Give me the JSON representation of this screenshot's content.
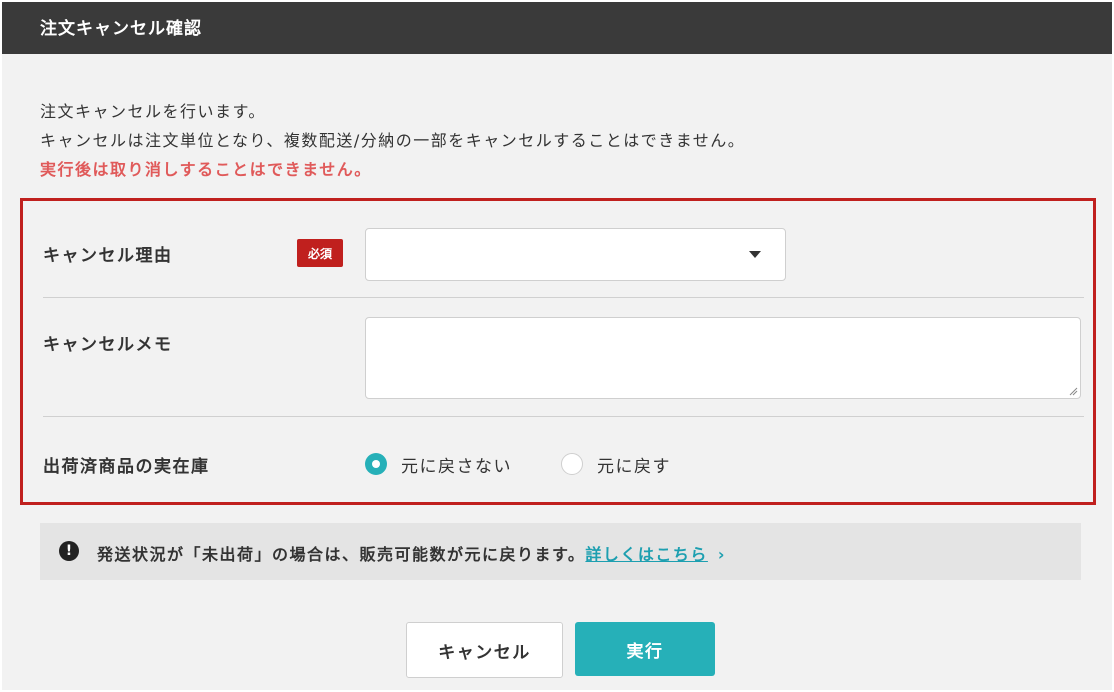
{
  "dialog": {
    "title": "注文キャンセル確認",
    "intro_line1": "注文キャンセルを行います。",
    "intro_line2": "キャンセルは注文単位となり、複数配送/分納の一部をキャンセルすることはできません。",
    "intro_warning": "実行後は取り消しすることはできません。"
  },
  "form": {
    "reason_label": "キャンセル理由",
    "required_badge": "必須",
    "reason_value": "",
    "memo_label": "キャンセルメモ",
    "memo_value": "",
    "stock_label": "出荷済商品の実在庫",
    "stock_options": [
      {
        "label": "元に戻さない",
        "selected": true
      },
      {
        "label": "元に戻す",
        "selected": false
      }
    ]
  },
  "notice": {
    "icon": "exclamation-icon",
    "text": "発送状況が「未出荷」の場合は、販売可能数が元に戻ります。",
    "link_text": "詳しくはこちら",
    "chevron": "›"
  },
  "buttons": {
    "cancel_label": "キャンセル",
    "execute_label": "実行"
  },
  "colors": {
    "title_bar": "#3a3a3a",
    "warning_text": "#e05a5a",
    "required_badge": "#c0201e",
    "accent": "#26b0b8",
    "link": "#1d9fb0"
  }
}
